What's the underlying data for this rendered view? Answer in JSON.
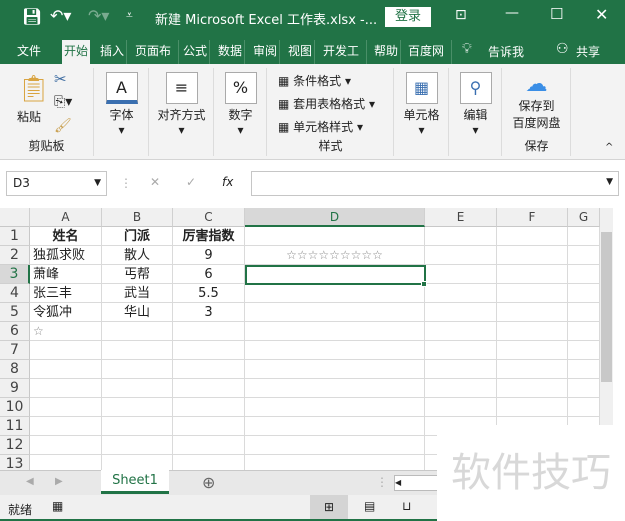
{
  "title": {
    "doc": "新建 Microsoft Excel 工作表.xlsx  -...",
    "login": "登录"
  },
  "tabs": [
    "文件",
    "开始",
    "插入",
    "页面布局",
    "公式",
    "数据",
    "审阅",
    "视图",
    "开发工具",
    "帮助",
    "百度网盘"
  ],
  "tell": "告诉我",
  "share": "共享",
  "ribbon": {
    "paste": "粘贴",
    "clipboard": "剪贴板",
    "font": "字体",
    "align": "对齐方式",
    "number": "数字",
    "cond": "条件格式",
    "table": "套用表格格式",
    "cellstyle": "单元格样式",
    "styles": "样式",
    "cells": "单元格",
    "edit": "编辑",
    "save1": "保存到",
    "save2": "百度网盘",
    "save": "保存"
  },
  "formula": {
    "namebox": "D3",
    "value": "",
    "fx": "fx"
  },
  "columns": [
    "A",
    "B",
    "C",
    "D",
    "E",
    "F",
    "G"
  ],
  "rows": [
    "1",
    "2",
    "3",
    "4",
    "5",
    "6",
    "7",
    "8",
    "9",
    "10",
    "11",
    "12",
    "13"
  ],
  "cells": [
    [
      "姓名",
      "门派",
      "厉害指数",
      ""
    ],
    [
      "独孤求败",
      "散人",
      "9",
      "☆☆☆☆☆☆☆☆☆"
    ],
    [
      "萧峰",
      "丐帮",
      "6",
      ""
    ],
    [
      "张三丰",
      "武当",
      "5.5",
      ""
    ],
    [
      "令狐冲",
      "华山",
      "3",
      ""
    ],
    [
      "☆",
      "",
      "",
      ""
    ]
  ],
  "active_cell": "D3",
  "sheet": "Sheet1",
  "status": "就绪",
  "watermark": "软件技巧",
  "colors": {
    "accent": "#217346"
  }
}
